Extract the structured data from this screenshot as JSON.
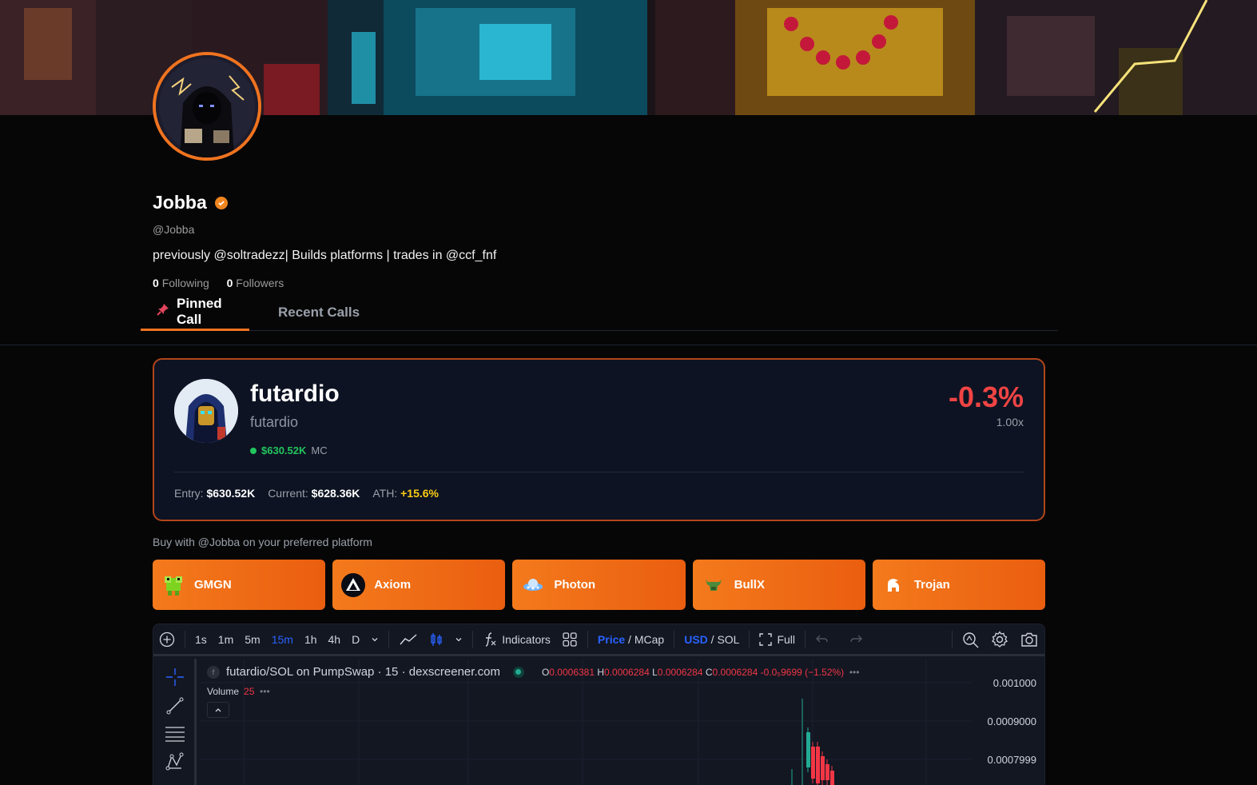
{
  "profile": {
    "name": "Jobba",
    "handle": "@Jobba",
    "bio": "previously @soltradezz| Builds platforms | trades in @ccf_fnf",
    "following_count": "0",
    "following_label": "Following",
    "followers_count": "0",
    "followers_label": "Followers"
  },
  "tabs": [
    {
      "label": "Pinned Call",
      "active": true
    },
    {
      "label": "Recent Calls",
      "active": false
    }
  ],
  "call": {
    "coin_name": "futardio",
    "coin_sub": "futardio",
    "mc_value": "$630.52K",
    "mc_label": "MC",
    "change": "-0.3%",
    "multiplier": "1.00x",
    "entry_label": "Entry:",
    "entry": "$630.52K",
    "current_label": "Current:",
    "current": "$628.36K",
    "ath_label": "ATH:",
    "ath": "+15.6%"
  },
  "buy": {
    "title": "Buy with @Jobba on your preferred platform",
    "platforms": [
      "GMGN",
      "Axiom",
      "Photon",
      "BullX",
      "Trojan"
    ]
  },
  "chart": {
    "timeframes": [
      "1s",
      "1m",
      "5m",
      "15m",
      "1h",
      "4h",
      "D"
    ],
    "active_timeframe": "15m",
    "indicators_label": "Indicators",
    "price_label": "Price",
    "mcap_label": "MCap",
    "usd_label": "USD",
    "sol_label": "SOL",
    "full_label": "Full",
    "legend_title": "futardio/SOL on PumpSwap · 15 · dexscreener.com",
    "ohlc": {
      "o": "0.0006381",
      "h": "0.0006284",
      "l": "0.0006284",
      "c": "0.0006284",
      "change": "-0.0₅9699 (−1.52%)"
    },
    "volume_label": "Volume",
    "volume_value": "25",
    "price_ticks": [
      "0.001000",
      "0.0009000",
      "0.0007999"
    ]
  },
  "colors": {
    "accent": "#f0731f",
    "down": "#ef4444",
    "up": "#22c55e",
    "ath": "#facc15"
  }
}
